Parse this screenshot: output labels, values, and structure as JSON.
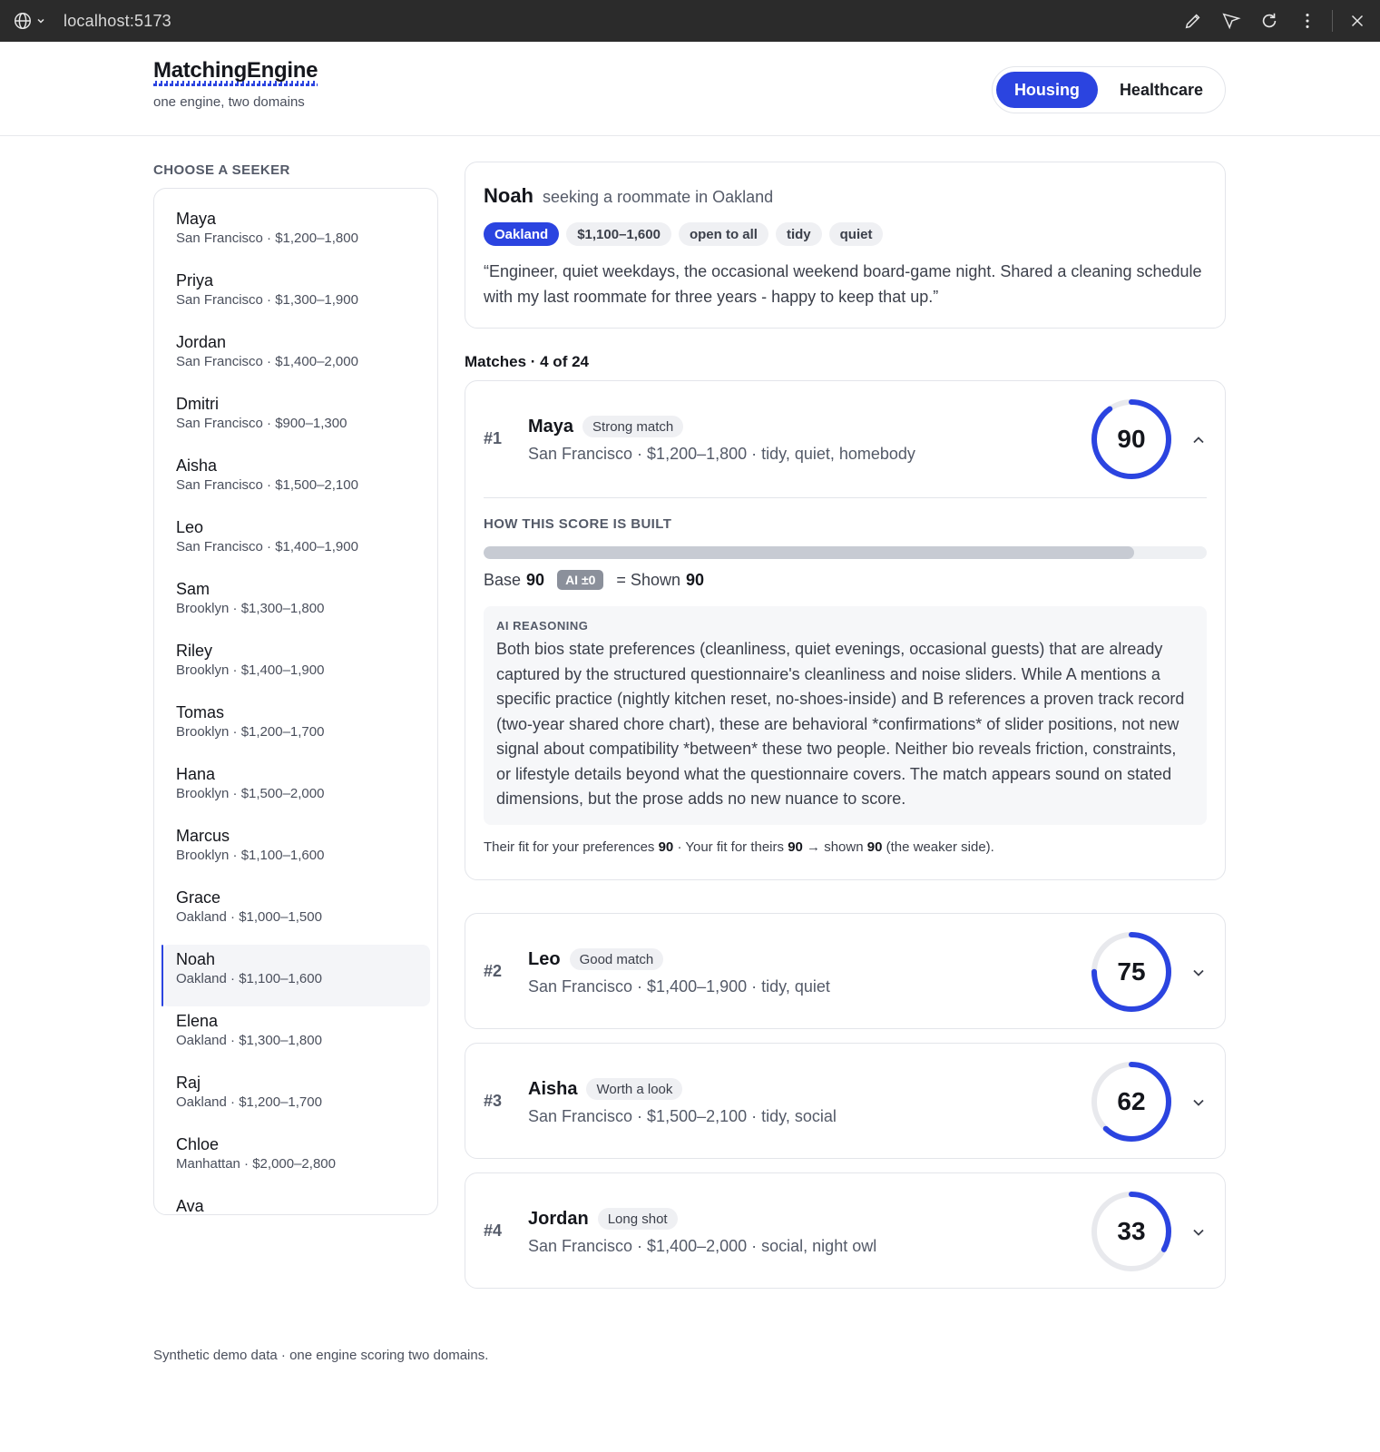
{
  "browser": {
    "url": "localhost:5173"
  },
  "app": {
    "title": "MatchingEngine",
    "subtitle": "one engine, two domains"
  },
  "domains": [
    {
      "label": "Housing",
      "active": true
    },
    {
      "label": "Healthcare",
      "active": false
    }
  ],
  "sidebar": {
    "label": "CHOOSE A SEEKER",
    "seekers": [
      {
        "name": "Maya",
        "meta": "San Francisco · $1,200–1,800"
      },
      {
        "name": "Priya",
        "meta": "San Francisco · $1,300–1,900"
      },
      {
        "name": "Jordan",
        "meta": "San Francisco · $1,400–2,000"
      },
      {
        "name": "Dmitri",
        "meta": "San Francisco · $900–1,300"
      },
      {
        "name": "Aisha",
        "meta": "San Francisco · $1,500–2,100"
      },
      {
        "name": "Leo",
        "meta": "San Francisco · $1,400–1,900"
      },
      {
        "name": "Sam",
        "meta": "Brooklyn · $1,300–1,800"
      },
      {
        "name": "Riley",
        "meta": "Brooklyn · $1,400–1,900"
      },
      {
        "name": "Tomas",
        "meta": "Brooklyn · $1,200–1,700"
      },
      {
        "name": "Hana",
        "meta": "Brooklyn · $1,500–2,000"
      },
      {
        "name": "Marcus",
        "meta": "Brooklyn · $1,100–1,600"
      },
      {
        "name": "Grace",
        "meta": "Oakland · $1,000–1,500"
      },
      {
        "name": "Noah",
        "meta": "Oakland · $1,100–1,600",
        "active": true
      },
      {
        "name": "Elena",
        "meta": "Oakland · $1,300–1,800"
      },
      {
        "name": "Raj",
        "meta": "Oakland · $1,200–1,700"
      },
      {
        "name": "Chloe",
        "meta": "Manhattan · $2,000–2,800"
      },
      {
        "name": "Ava",
        "meta": ""
      }
    ]
  },
  "profile": {
    "name": "Noah",
    "seeking": "seeking a roommate in Oakland",
    "tags": [
      "Oakland",
      "$1,100–1,600",
      "open to all",
      "tidy",
      "quiet"
    ],
    "bio": "“Engineer, quiet weekdays, the occasional weekend board-game night. Shared a cleaning schedule with my last roommate for three years - happy to keep that up.”"
  },
  "matches_label": "Matches · 4 of 24",
  "matches": [
    {
      "rank": "#1",
      "name": "Maya",
      "badge": "Strong match",
      "sub": "San Francisco · $1,200–1,800 · tidy, quiet, homebody",
      "score": 90,
      "score_text": "90",
      "expanded": true,
      "breakdown": {
        "label": "HOW THIS SCORE IS BUILT",
        "bar_fraction": 0.9,
        "base_label": "Base",
        "base_value": "90",
        "ai_chip": "AI ±0",
        "shown_label": "= Shown",
        "shown_value": "90",
        "ai_label": "AI REASONING",
        "ai_text": "Both bios state preferences (cleanliness, quiet evenings, occasional guests) that are already captured by the structured questionnaire's cleanliness and noise sliders. While A mentions a specific practice (nightly kitchen reset, no-shoes-inside) and B references a proven track record (two-year shared chore chart), these are behavioral *confirmations* of slider positions, not new signal about compatibility *between* these two people. Neither bio reveals friction, constraints, or lifestyle details beyond what the questionnaire covers. The match appears sound on stated dimensions, but the prose adds no new nuance to score.",
        "fit_a": "Their fit for your preferences",
        "fit_a_val": "90",
        "fit_b": "· Your fit for theirs",
        "fit_b_val": "90",
        "fit_c": "→ shown",
        "fit_c_val": "90",
        "fit_d": "(the weaker side)."
      }
    },
    {
      "rank": "#2",
      "name": "Leo",
      "badge": "Good match",
      "sub": "San Francisco · $1,400–1,900 · tidy, quiet",
      "score": 75,
      "score_text": "75",
      "expanded": false
    },
    {
      "rank": "#3",
      "name": "Aisha",
      "badge": "Worth a look",
      "sub": "San Francisco · $1,500–2,100 · tidy, social",
      "score": 62,
      "score_text": "62",
      "expanded": false
    },
    {
      "rank": "#4",
      "name": "Jordan",
      "badge": "Long shot",
      "sub": "San Francisco · $1,400–2,000 · social, night owl",
      "score": 33,
      "score_text": "33",
      "expanded": false
    }
  ],
  "footer": "Synthetic demo data · one engine scoring two domains.",
  "colors": {
    "accent": "#2b44e0",
    "track": "#e8e9ed"
  }
}
